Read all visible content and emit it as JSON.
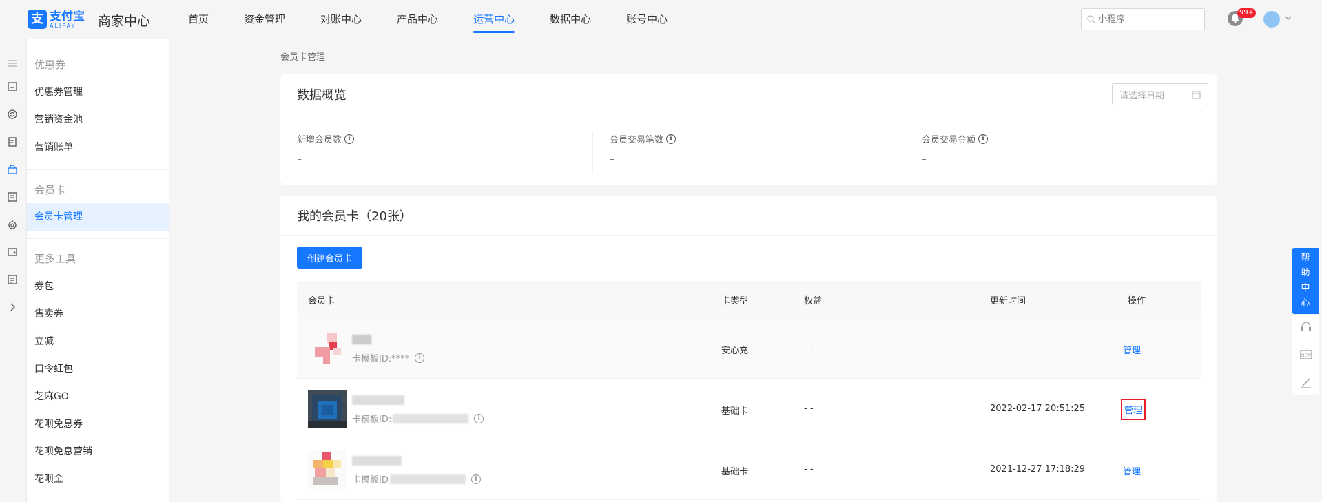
{
  "header": {
    "logo_cn": "支付宝",
    "logo_en": "ALIPAY",
    "brand_title": "商家中心",
    "nav": [
      "首页",
      "资金管理",
      "对账中心",
      "产品中心",
      "运营中心",
      "数据中心",
      "账号中心"
    ],
    "active_nav": "运营中心",
    "search_placeholder": "小程序",
    "notification_badge": "99+"
  },
  "sidebar": {
    "groups": [
      {
        "title": "优惠券",
        "items": [
          "优惠券管理",
          "营销资金池",
          "营销账单"
        ]
      },
      {
        "title": "会员卡",
        "items": [
          "会员卡管理"
        ]
      },
      {
        "title": "更多工具",
        "items": [
          "券包",
          "售卖券",
          "立减",
          "口令红包",
          "芝麻GO",
          "花呗免息券",
          "花呗免息营销",
          "花呗金"
        ]
      }
    ],
    "active_item": "会员卡管理"
  },
  "breadcrumb": "会员卡管理",
  "overview": {
    "title": "数据概览",
    "date_placeholder": "请选择日期",
    "stats": [
      {
        "label": "新增会员数",
        "value": "-"
      },
      {
        "label": "会员交易笔数",
        "value": "-"
      },
      {
        "label": "会员交易金额",
        "value": "-"
      }
    ]
  },
  "cards": {
    "title": "我的会员卡（20张）",
    "create_button": "创建会员卡",
    "columns": [
      "会员卡",
      "卡类型",
      "权益",
      "更新时间",
      "操作"
    ],
    "rows": [
      {
        "template_id": "卡模板ID:****",
        "card_type": "安心充",
        "benefit": "- -",
        "updated": "",
        "action": "管理"
      },
      {
        "template_id": "卡模板ID:",
        "card_type": "基础卡",
        "benefit": "- -",
        "updated": "2022-02-17 20:51:25",
        "action": "管理"
      },
      {
        "template_id": "卡模板ID",
        "card_type": "基础卡",
        "benefit": "- -",
        "updated": "2021-12-27 17:18:29",
        "action": "管理"
      }
    ]
  },
  "help_float": {
    "label": [
      "帮",
      "助",
      "中",
      "心"
    ]
  },
  "colors": {
    "brand": "#1677ff",
    "highlight_box": "#e8202c"
  }
}
